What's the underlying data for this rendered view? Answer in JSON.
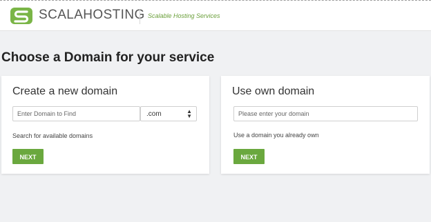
{
  "header": {
    "brand": "SCALAHOSTING",
    "tagline": "Scalable Hosting Services",
    "logo_icon": "scalahosting-logo-icon"
  },
  "page": {
    "title": "Choose a Domain for your service"
  },
  "new_domain": {
    "title": "Create a new domain",
    "input_placeholder": "Enter Domain to Find",
    "input_value": "",
    "tld_selected": ".com",
    "help_text": "Search for available domains",
    "next_label": "NEXT"
  },
  "own_domain": {
    "title": "Use own domain",
    "input_placeholder": "Please enter your domain",
    "input_value": "",
    "help_text": "Use a domain you already own",
    "next_label": "NEXT"
  },
  "colors": {
    "accent_green": "#6aa83e",
    "tagline_green": "#6a9f3a",
    "background": "#f0f1f3"
  }
}
